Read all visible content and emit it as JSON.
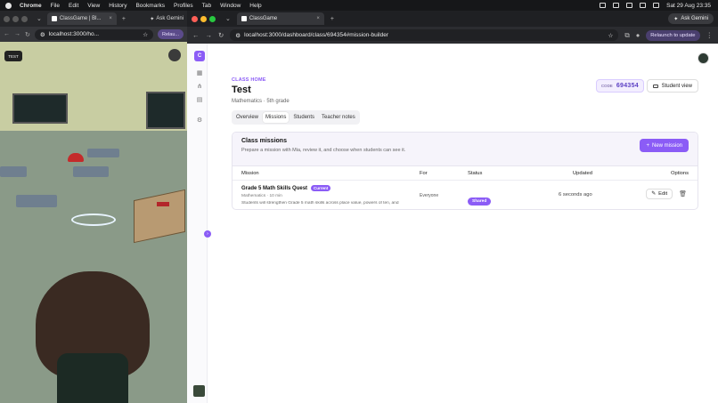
{
  "menubar": {
    "app": "Chrome",
    "items": [
      "File",
      "Edit",
      "View",
      "History",
      "Bookmarks",
      "Profiles",
      "Tab",
      "Window",
      "Help"
    ],
    "clock": "Sat 29 Aug  23:35"
  },
  "left_window": {
    "tab_title": "ClassGame | Bl...",
    "ask_gemini": "Ask Gemini",
    "url": "localhost:3000/ho...",
    "relaunch": "Relau...",
    "hud_label": "TEST"
  },
  "right_window": {
    "tab_title": "ClassGame",
    "ask_gemini": "Ask Gemini",
    "url": "localhost:3000/dashboard/class/694354#mission-builder",
    "relaunch": "Relaunch to update"
  },
  "app": {
    "logo_letter": "C",
    "eyebrow": "CLASS HOME",
    "class_title": "Test",
    "subtitle": "Mathematics · 5th grade",
    "code_label": "CODE",
    "code_value": "694354",
    "student_view": "Student view",
    "tabs": [
      "Overview",
      "Missions",
      "Students",
      "Teacher notes"
    ],
    "active_tab": "Missions",
    "missions": {
      "title": "Class missions",
      "description": "Prepare a mission with Mia, review it, and choose when students can see it.",
      "new_button": "New mission",
      "columns": [
        "Mission",
        "For",
        "Status",
        "Updated",
        "Options"
      ],
      "rows": [
        {
          "name": "Grade 5 Math Skills Quest",
          "badge": "Current",
          "meta": "Mathematics · 10 min",
          "desc": "Students will strengthen Grade 5 math skills across place value, powers of ten, and",
          "for": "Everyone",
          "status": "Shared",
          "updated": "6 seconds ago",
          "edit": "Edit"
        }
      ]
    }
  },
  "colors": {
    "accent": "#8b5cf6",
    "accent_light": "#f3eeff"
  }
}
